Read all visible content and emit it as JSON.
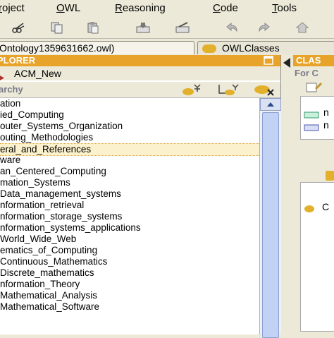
{
  "menu": [
    "roject",
    "OWL",
    "Reasoning",
    "Code",
    "Tools"
  ],
  "tabs": {
    "file_tab": "Ontology1359631662.owl)",
    "owl_tab": "OWLClasses"
  },
  "explorer": {
    "header": "PLORER",
    "ontology_name": "ACM_New",
    "hierarchy_label": "archy"
  },
  "tree_items": [
    "ation",
    "ied_Computing",
    "outer_Systems_Organization",
    "outing_Methodologies",
    "eral_and_References",
    "ware",
    "an_Centered_Computing",
    "mation_Systems",
    "Data_management_systems",
    "nformation_retrieval",
    "nformation_storage_systems",
    "nformation_systems_applications",
    "World_Wide_Web",
    "ematics_of_Computing",
    "Continuous_Mathematics",
    "Discrete_mathematics",
    "nformation_Theory",
    "Mathematical_Analysis",
    "Mathematical_Software"
  ],
  "right_panel": {
    "header": "CLAS",
    "for_label": "For C",
    "item1": "n",
    "item2": "n",
    "item3": "C"
  },
  "colors": {
    "header_orange": "#e7a32a",
    "selection": "#fcf1cd",
    "window_bg": "#ece9d8"
  }
}
